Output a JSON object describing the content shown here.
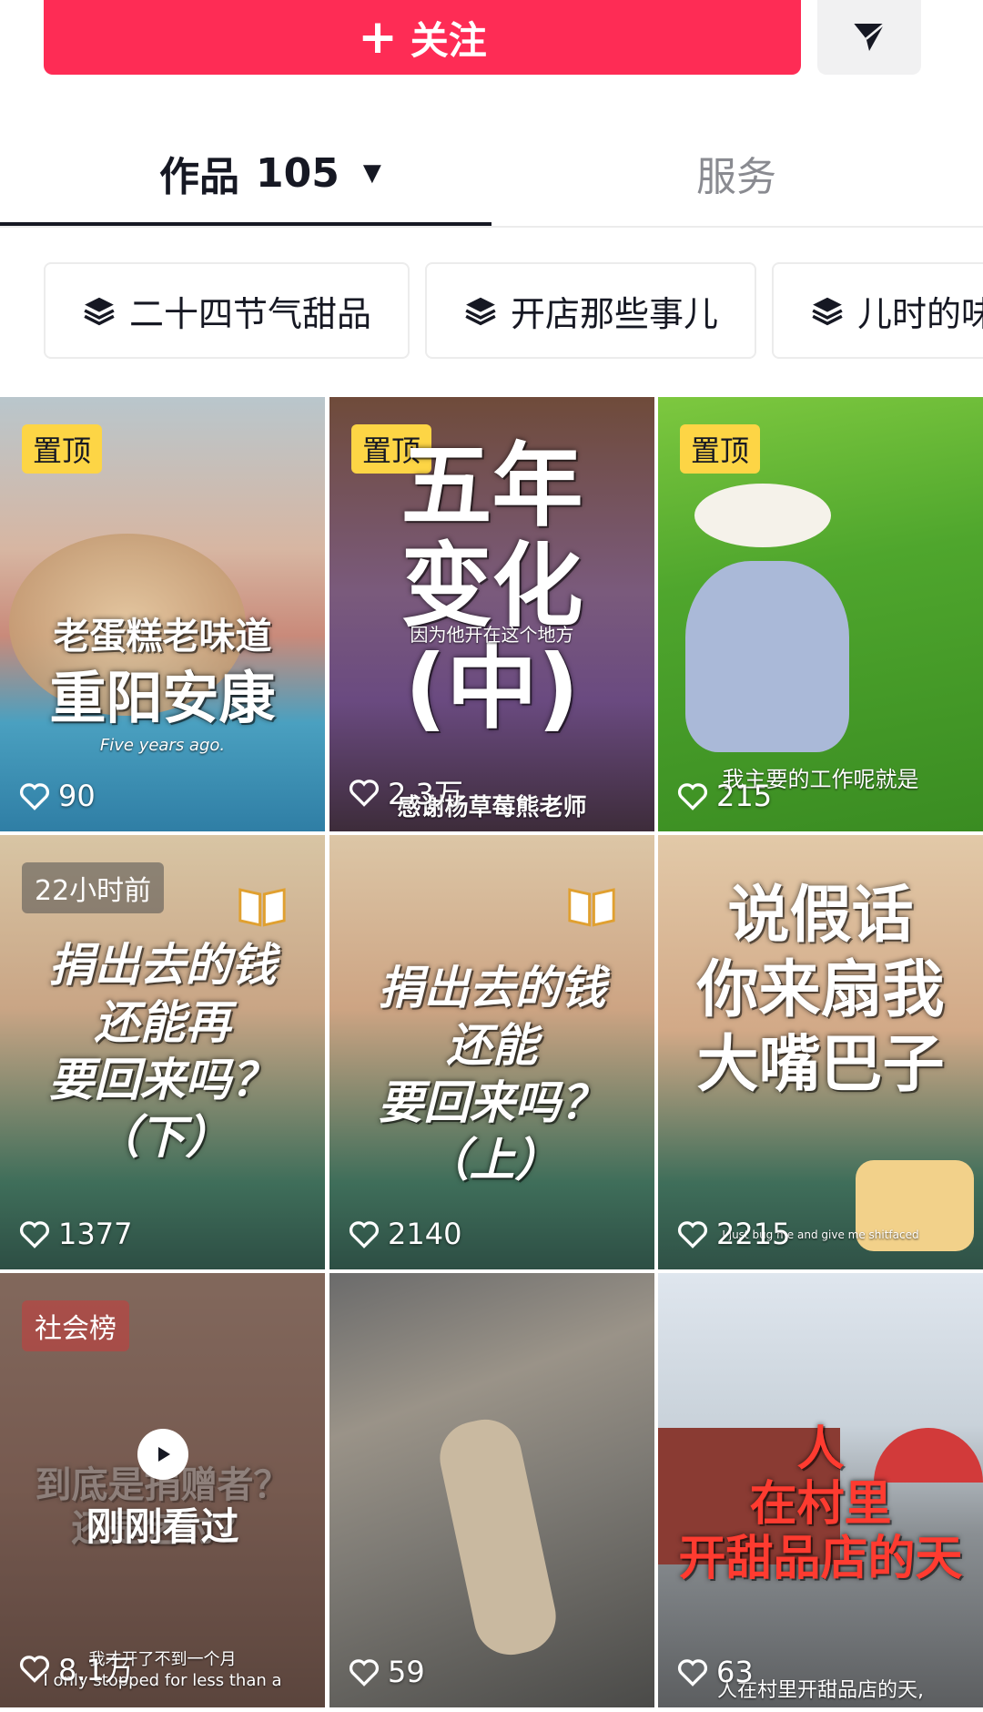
{
  "header": {
    "follow_label": "关注",
    "follow_color": "#fe2c55"
  },
  "tabs": {
    "works_label": "作品",
    "works_count": "105",
    "service_label": "服务"
  },
  "collections": [
    {
      "label": "二十四节气甜品",
      "icon": "layers-icon"
    },
    {
      "label": "开店那些事儿",
      "icon": "layers-icon"
    },
    {
      "label": "儿时的味",
      "icon": "layers-icon"
    }
  ],
  "videos": [
    {
      "badge": "置顶",
      "title": [
        "老蛋糕老味道",
        "重阳安康"
      ],
      "caption": "Five years ago.",
      "likes": "90"
    },
    {
      "badge": "置顶",
      "title": [
        "五年",
        "变化",
        "(中)"
      ],
      "caption": "因为他开在这个地方",
      "likes": "2.3万",
      "subcaption": "感谢杨草莓熊老师"
    },
    {
      "badge": "置顶",
      "caption": "我主要的工作呢就是",
      "likes": "215"
    },
    {
      "badge": "22小时前",
      "title": [
        "捐出去的钱",
        "还能再",
        "要回来吗？",
        "（下）"
      ],
      "likes": "1377"
    },
    {
      "title": [
        "捐出去的钱",
        "还能",
        "要回来吗？",
        "（上）"
      ],
      "likes": "2140"
    },
    {
      "title": [
        "说假话",
        "你来扇我",
        "大嘴巴子"
      ],
      "caption": "I just bug me and give me shitfaced",
      "likes": "2215"
    },
    {
      "badge": "社会榜",
      "bg_text": [
        "到底是捐赠者？",
        "还是乞讨？"
      ],
      "watched_label": "刚刚看过",
      "caption": "我才开了不到一个月",
      "caption2": "I only stopped for less than a",
      "likes": "8.1万"
    },
    {
      "likes": "59"
    },
    {
      "title": [
        "人",
        "在村里",
        "开甜品店的天"
      ],
      "caption": "人在村里开甜品店的天,",
      "likes": "63"
    }
  ]
}
